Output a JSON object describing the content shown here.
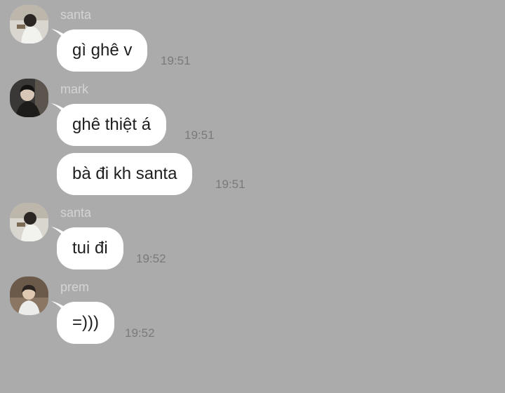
{
  "chat": {
    "messages": [
      {
        "sender": "santa",
        "avatar": "santa-avatar",
        "text": "gì ghê v",
        "time": "19:51"
      },
      {
        "sender": "mark",
        "avatar": "mark-avatar",
        "text": "ghê thiệt á",
        "time": "19:51"
      },
      {
        "sender": "mark",
        "text": "bà đi kh santa",
        "time": "19:51"
      },
      {
        "sender": "santa",
        "avatar": "santa-avatar",
        "text": "tui đi",
        "time": "19:52"
      },
      {
        "sender": "prem",
        "avatar": "prem-avatar",
        "text": "=)))",
        "time": "19:52"
      }
    ]
  },
  "colors": {
    "background": "#ababab",
    "bubble": "#ffffff",
    "sender_name": "#d4d4d4",
    "timestamp": "#7a7a7a"
  }
}
